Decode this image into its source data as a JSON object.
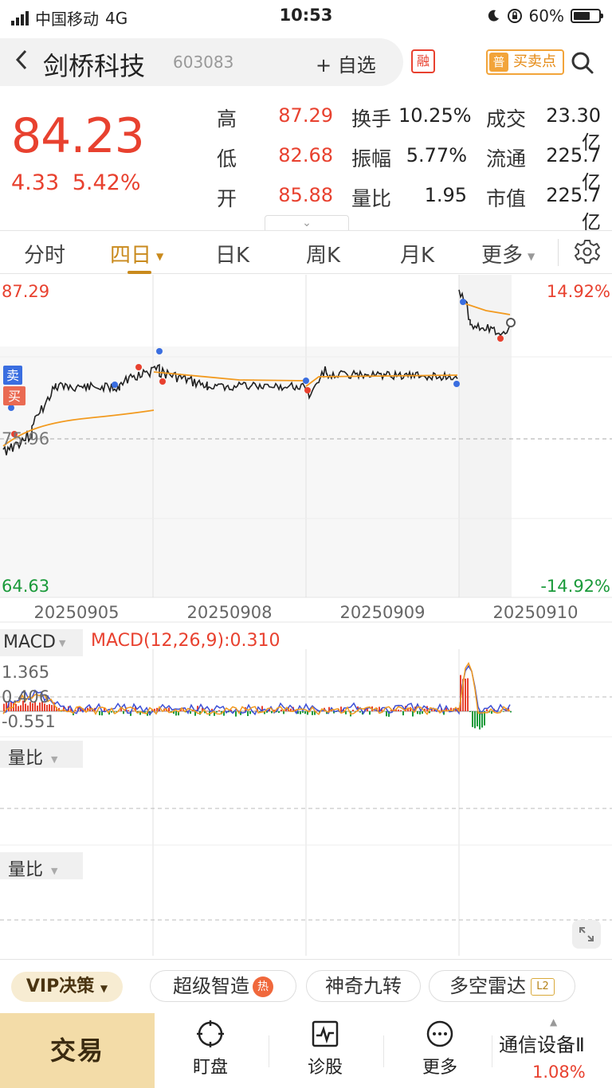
{
  "status_bar": {
    "carrier": "中国移动",
    "network": "4G",
    "time": "10:53",
    "battery": "60%"
  },
  "header": {
    "stock_name": "剑桥科技",
    "stock_code": "603083",
    "watchlist_label": "+ 自选",
    "margin_badge": "融",
    "bsp_badge": "普",
    "bsp_label": "买卖点"
  },
  "quote": {
    "price": "84.23",
    "change": "4.33",
    "change_pct": "5.42%",
    "stats": [
      {
        "label": "高",
        "value": "87.29",
        "color": "red"
      },
      {
        "label": "换手",
        "value": "10.25%",
        "color": "black"
      },
      {
        "label": "成交",
        "value": "23.30亿",
        "color": "black"
      },
      {
        "label": "低",
        "value": "82.68",
        "color": "red"
      },
      {
        "label": "振幅",
        "value": "5.77%",
        "color": "black"
      },
      {
        "label": "流通",
        "value": "225.7亿",
        "color": "black"
      },
      {
        "label": "开",
        "value": "85.88",
        "color": "red"
      },
      {
        "label": "量比",
        "value": "1.95",
        "color": "black"
      },
      {
        "label": "市值",
        "value": "225.7亿",
        "color": "black"
      }
    ]
  },
  "tabs": [
    {
      "label": "分时",
      "active": false,
      "caret": false
    },
    {
      "label": "四日",
      "active": true,
      "caret": true
    },
    {
      "label": "日K",
      "active": false,
      "caret": false
    },
    {
      "label": "周K",
      "active": false,
      "caret": false
    },
    {
      "label": "月K",
      "active": false,
      "caret": false
    },
    {
      "label": "更多",
      "active": false,
      "caret": true
    }
  ],
  "chart": {
    "y_max": "87.29",
    "y_min": "64.63",
    "y_mid": "75.96",
    "pct_max": "14.92%",
    "pct_min": "-14.92%",
    "sell_badge": "卖",
    "buy_badge": "买",
    "dates": [
      "20250905",
      "20250908",
      "20250909",
      "20250910"
    ]
  },
  "chart_data": {
    "type": "line",
    "x": [
      "20250905",
      "20250908",
      "20250909",
      "20250910"
    ],
    "series": [],
    "ylim": [
      64.63,
      87.29
    ],
    "y_ref": 75.96,
    "y_pct_range": [
      "-14.92%",
      "14.92%"
    ]
  },
  "macd": {
    "title": "MACD",
    "value_label": "MACD(12,26,9):0.310",
    "tick_top": "1.365",
    "tick_mid": "0.406",
    "tick_bot": "-0.551"
  },
  "ratio_panels": [
    "量比",
    "量比"
  ],
  "feature_bar": {
    "vip": "VIP决策",
    "items": [
      "超级智造",
      "神奇九转",
      "多空雷达"
    ],
    "hot_badge": "热",
    "l2_badge": "L2"
  },
  "bottom_nav": {
    "trade": "交易",
    "items": [
      "盯盘",
      "诊股",
      "更多"
    ],
    "industry": "通信设备Ⅱ",
    "industry_pct": "1.08%"
  },
  "colors": {
    "red": "#e8412f",
    "green": "#1a9a3a",
    "gold": "#c98a1d",
    "avg_line": "#f29a1f",
    "macd_dif": "#3d4fd6",
    "macd_dea": "#f29a1f"
  }
}
